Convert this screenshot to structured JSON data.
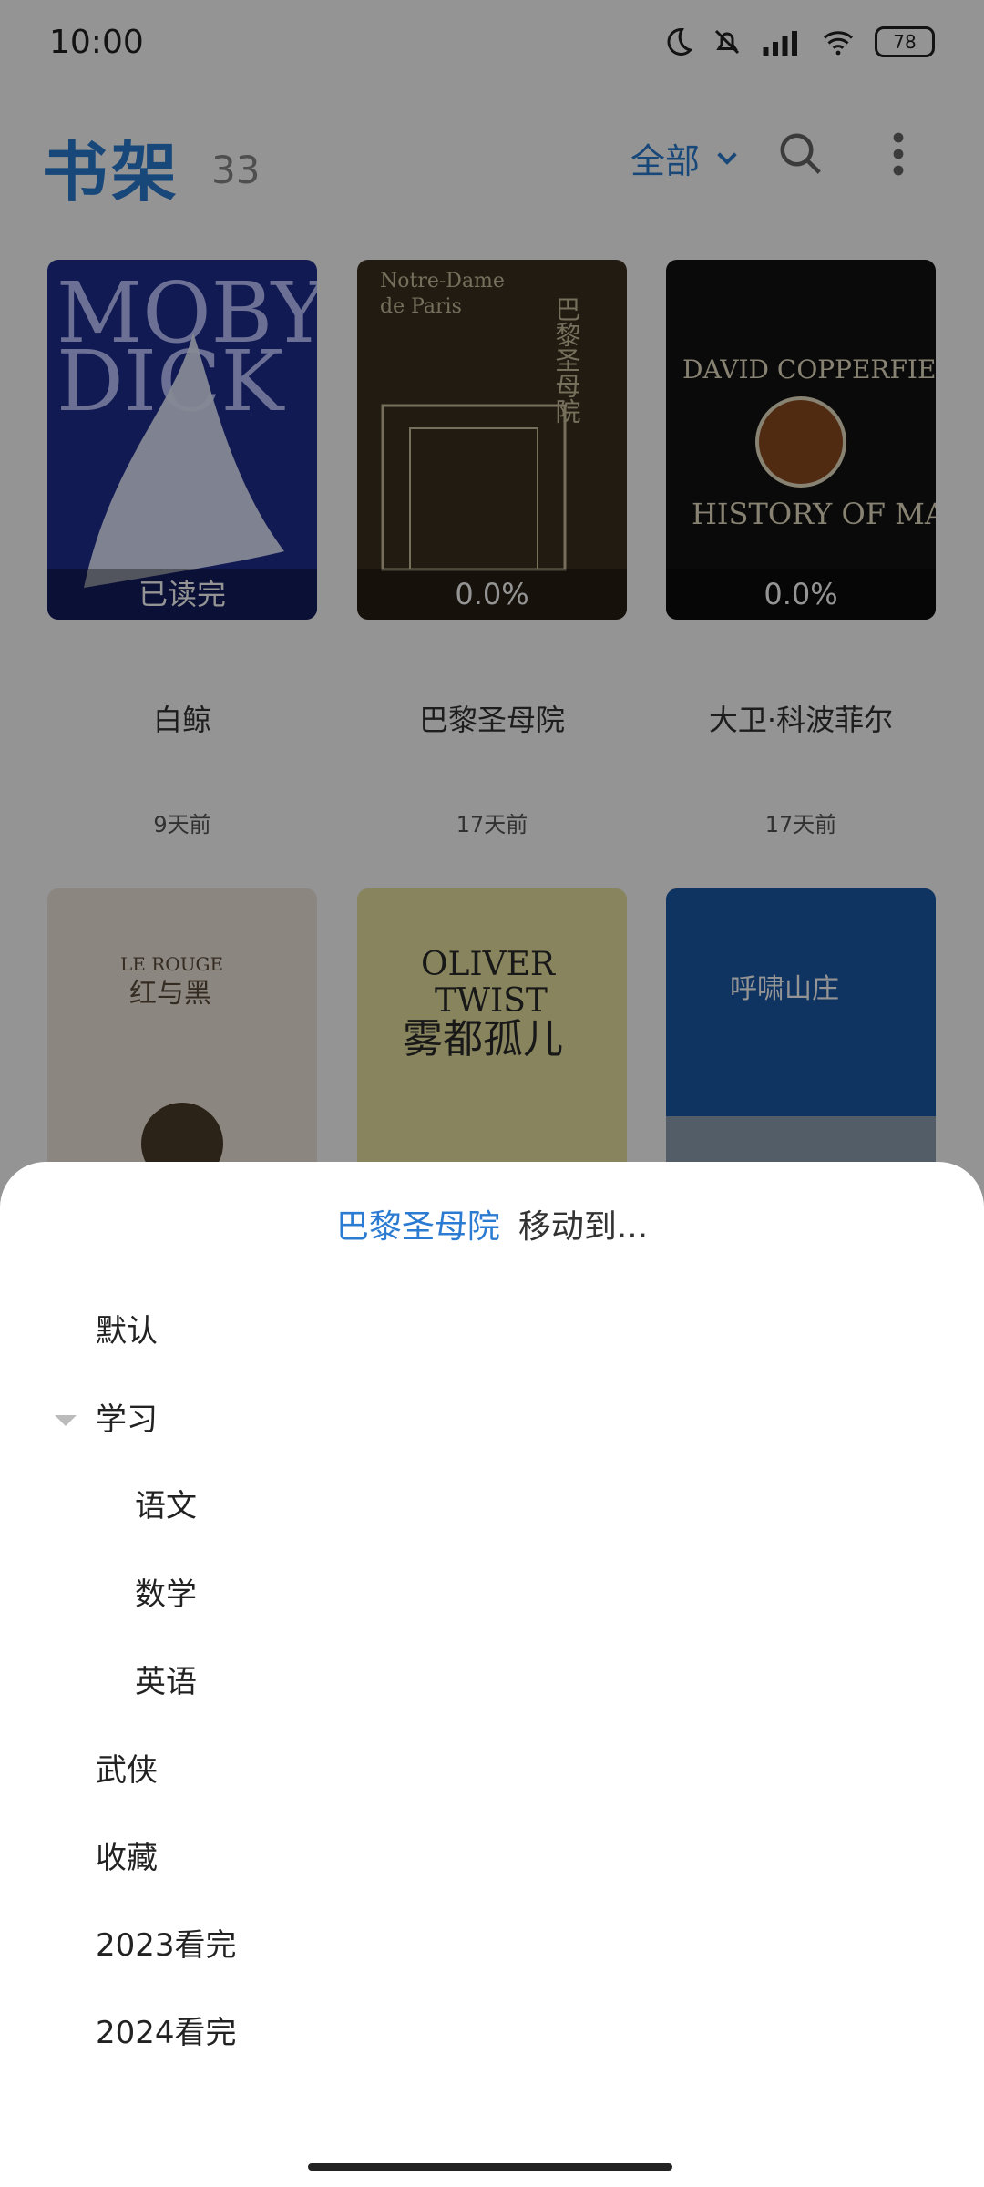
{
  "status_bar": {
    "time": "10:00",
    "battery": "78"
  },
  "app_bar": {
    "title": "书架",
    "count": "33",
    "filter_label": "全部"
  },
  "books": [
    {
      "title": "白鲸",
      "time": "9天前",
      "progress": "已读完",
      "cover_colors": [
        "#1e2d8f",
        "#2b3fa5"
      ]
    },
    {
      "title": "巴黎圣母院",
      "time": "17天前",
      "progress": "0.0%",
      "cover_colors": [
        "#2b2318",
        "#4a3b25"
      ]
    },
    {
      "title": "大卫·科波菲尔",
      "time": "17天前",
      "progress": "0.0%",
      "cover_colors": [
        "#111111",
        "#2b2b2b"
      ]
    },
    {
      "title": "",
      "time": "",
      "progress": "",
      "cover_colors": [
        "#efe7dd",
        "#d7cbbd"
      ]
    },
    {
      "title": "",
      "time": "",
      "progress": "",
      "cover_colors": [
        "#e9e3a2",
        "#cbbf66"
      ]
    },
    {
      "title": "",
      "time": "",
      "progress": "",
      "cover_colors": [
        "#1b5aa8",
        "#3f83cf"
      ]
    }
  ],
  "sheet": {
    "book_name": "巴黎圣母院",
    "move_to": "移动到...",
    "folders": [
      {
        "label": "默认"
      },
      {
        "label": "学习"
      },
      {
        "label": "语文"
      },
      {
        "label": "数学"
      },
      {
        "label": "英语"
      },
      {
        "label": "武侠"
      },
      {
        "label": "收藏"
      },
      {
        "label": "2023看完"
      },
      {
        "label": "2024看完"
      }
    ]
  },
  "colors": {
    "accent": "#2a7bd1"
  }
}
